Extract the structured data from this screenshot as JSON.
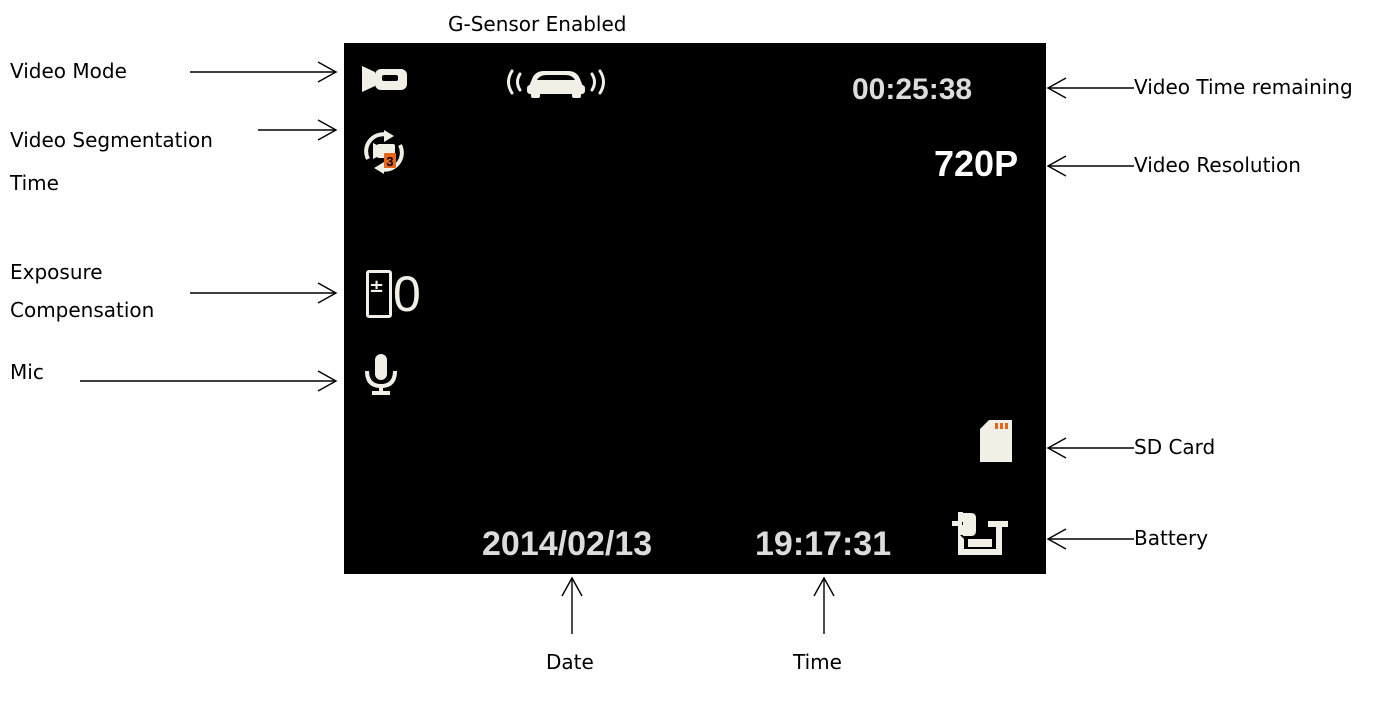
{
  "labels": {
    "g_sensor": "G-Sensor Enabled",
    "video_mode": "Video Mode",
    "segmentation_line1": "Video Segmentation",
    "segmentation_line2": "Time",
    "exposure_line1": "Exposure",
    "exposure_line2": "Compensation",
    "mic": "Mic",
    "time_remaining": "Video Time remaining",
    "resolution": "Video Resolution",
    "sd_card": "SD Card",
    "battery": "Battery",
    "date": "Date",
    "time": "Time"
  },
  "screen": {
    "time_remaining": "00:25:38",
    "resolution": "720P",
    "exposure_value": "0",
    "segment_minutes": "3",
    "date": "2014/02/13",
    "clock": "19:17:31"
  },
  "colors": {
    "screen_bg": "#000000",
    "icon_light": "#f2f0e6",
    "accent_orange": "#e8661c",
    "text_grey": "#dcdcdc"
  },
  "icons": [
    "video-camera-icon",
    "g-sensor-car-icon",
    "segment-loop-icon",
    "exposure-icon",
    "mic-icon",
    "sd-card-icon",
    "battery-plug-icon"
  ]
}
